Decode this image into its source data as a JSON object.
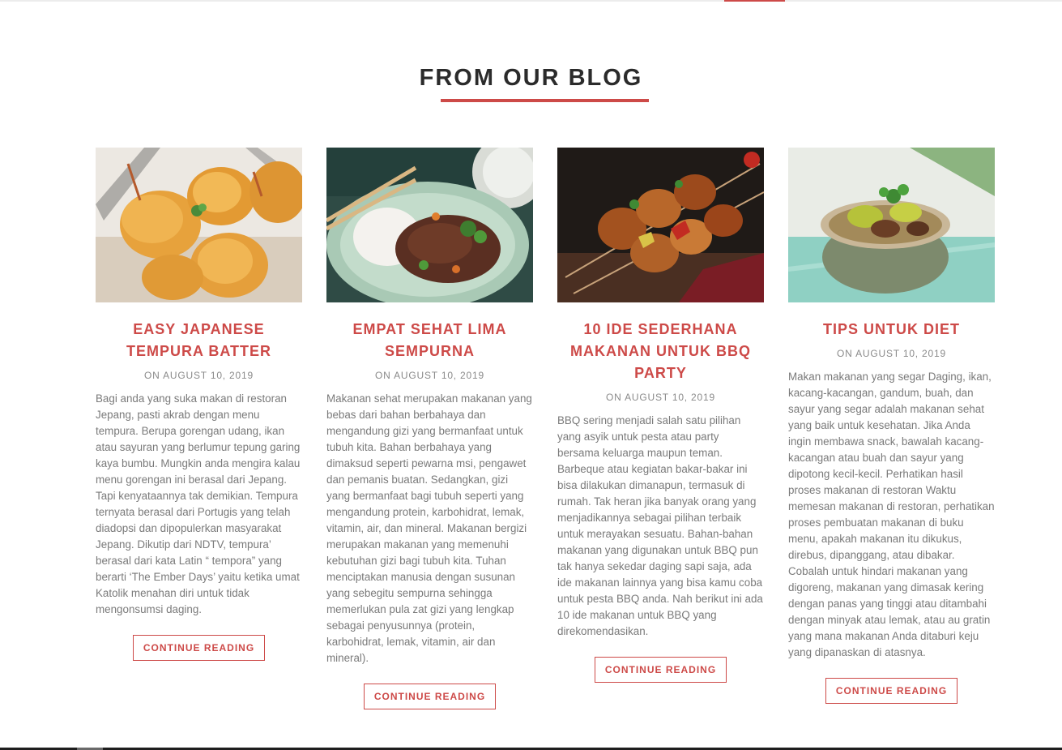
{
  "section": {
    "title": "FROM OUR BLOG"
  },
  "colors": {
    "accent": "#cd4a48",
    "heading": "#2b2b2b",
    "body_text": "#7a7a7a",
    "date_text": "#8a8a8a"
  },
  "posts": [
    {
      "title": "EASY JAPANESE TEMPURA BATTER",
      "date": "ON AUGUST 10, 2019",
      "excerpt": "Bagi anda yang suka makan di restoran Jepang, pasti akrab dengan menu tempura. Berupa gorengan udang, ikan atau sayuran yang berlumur tepung garing kaya bumbu. Mungkin anda mengira kalau menu gorengan ini berasal dari Jepang. Tapi kenyataannya tak demikian. Tempura ternyata berasal dari Portugis yang telah diadopsi dan dipopulerkan masyarakat Jepang. Dikutip dari NDTV, tempura’ berasal dari kata Latin “ tempora” yang berarti ‘The Ember Days’ yaitu ketika umat Katolik menahan diri untuk tidak mengonsumsi daging.",
      "button": "CONTINUE READING",
      "image": "fried-tempura-photo"
    },
    {
      "title": "EMPAT SEHAT LIMA SEMPURNA",
      "date": "ON AUGUST 10, 2019",
      "excerpt": "Makanan sehat merupakan makanan yang bebas dari bahan berbahaya dan mengandung gizi yang bermanfaat untuk tubuh kita. Bahan berbahaya yang dimaksud seperti pewarna msi, pengawet dan pemanis buatan. Sedangkan, gizi yang bermanfaat bagi tubuh seperti yang mengandung protein, karbohidrat, lemak, vitamin, air, dan mineral. Makanan bergizi merupakan makanan yang memenuhi kebutuhan gizi bagi tubuh kita. Tuhan menciptakan manusia dengan susunan yang sebegitu sempurna sehingga memerlukan pula zat gizi yang lengkap sebagai penyusunnya (protein, karbohidrat, lemak, vitamin, air dan mineral).",
      "button": "CONTINUE READING",
      "image": "rice-bowl-photo"
    },
    {
      "title": "10 IDE SEDERHANA MAKANAN UNTUK BBQ PARTY",
      "date": "ON AUGUST 10, 2019",
      "excerpt": "BBQ sering menjadi salah satu pilihan yang asyik untuk pesta atau party bersama keluarga maupun teman. Barbeque atau kegiatan bakar-bakar ini bisa dilakukan dimanapun, termasuk di rumah. Tak heran jika banyak orang yang menjadikannya sebagai pilihan terbaik untuk merayakan sesuatu. Bahan-bahan makanan yang digunakan untuk BBQ pun tak hanya sekedar daging sapi saja, ada ide makanan lainnya yang bisa kamu coba untuk pesta BBQ anda. Nah berikut ini ada 10 ide makanan untuk BBQ yang direkomendasikan.",
      "button": "CONTINUE READING",
      "image": "bbq-skewers-photo"
    },
    {
      "title": "TIPS UNTUK DIET",
      "date": "ON AUGUST 10, 2019",
      "excerpt": "Makan makanan yang segar Daging, ikan, kacang-kacangan, gandum, buah, dan sayur yang segar adalah makanan sehat yang baik untuk kesehatan. Jika Anda ingin membawa snack, bawalah kacang-kacangan atau buah dan sayur yang dipotong kecil-kecil. Perhatikan hasil proses makanan di restoran Waktu memesan makanan di restoran, perhatikan proses pembuatan makanan di buku menu, apakah makanan itu dikukus, direbus, dipanggang, atau dibakar. Cobalah untuk hindari makanan yang digoreng, makanan yang dimasak kering dengan panas yang tinggi atau ditambahi dengan minyak atau lemak, atau au gratin yang mana makanan Anda ditaburi keju yang dipanaskan di atasnya.",
      "button": "CONTINUE READING",
      "image": "vegetable-bowl-photo"
    }
  ]
}
